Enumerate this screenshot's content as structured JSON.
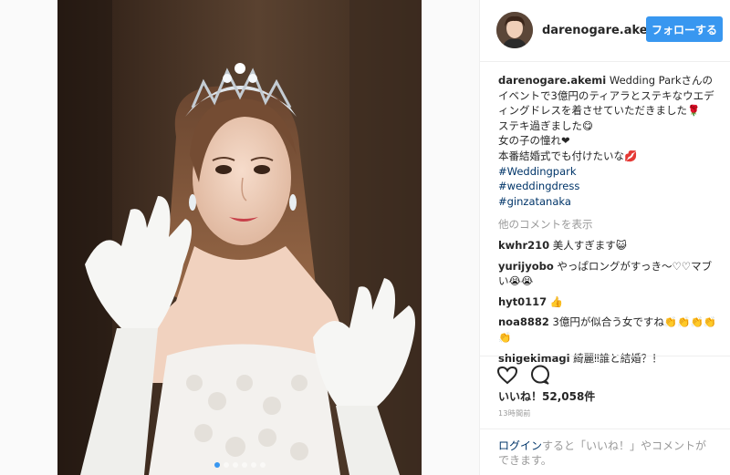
{
  "post": {
    "username": "darenogare.akemi",
    "follow_label": "フォローする",
    "carousel_count": 6,
    "carousel_active": 1
  },
  "caption": {
    "username": "darenogare.akemi",
    "line1": " Wedding Parkさんのイベントで3億円のティアラとステキなウエディングドレスを着させていただきました🌹",
    "line2": "ステキ過ぎました😋",
    "line3": "女の子の憧れ❤",
    "line4": "本番結婚式でも付けたいな💋",
    "hashtags": [
      "#Weddingpark",
      "#weddingdress",
      "#ginzatanaka"
    ]
  },
  "more_comments": "他のコメントを表示",
  "comments": [
    {
      "user": "kwhr210",
      "text": " 美人すぎます😺"
    },
    {
      "user": "yurijyobo",
      "text": " やっぱロングがすっき〜♡♡マブい😭😭"
    },
    {
      "user": "hyt0117",
      "text": " 👍"
    },
    {
      "user": "noa8882",
      "text": " 3億円が似合う女ですね👏👏👏👏👏"
    },
    {
      "user": "shigekimagi",
      "text": " 綺麗‼誰と結婚？！"
    }
  ],
  "likes": "いいね！52,058件",
  "timestamp": "13時間前",
  "login": {
    "link": "ログイン",
    "text": "すると「いいね！」やコメントができます。"
  },
  "colors": {
    "accent": "#3897f0",
    "link": "#003569",
    "muted": "#999999"
  }
}
